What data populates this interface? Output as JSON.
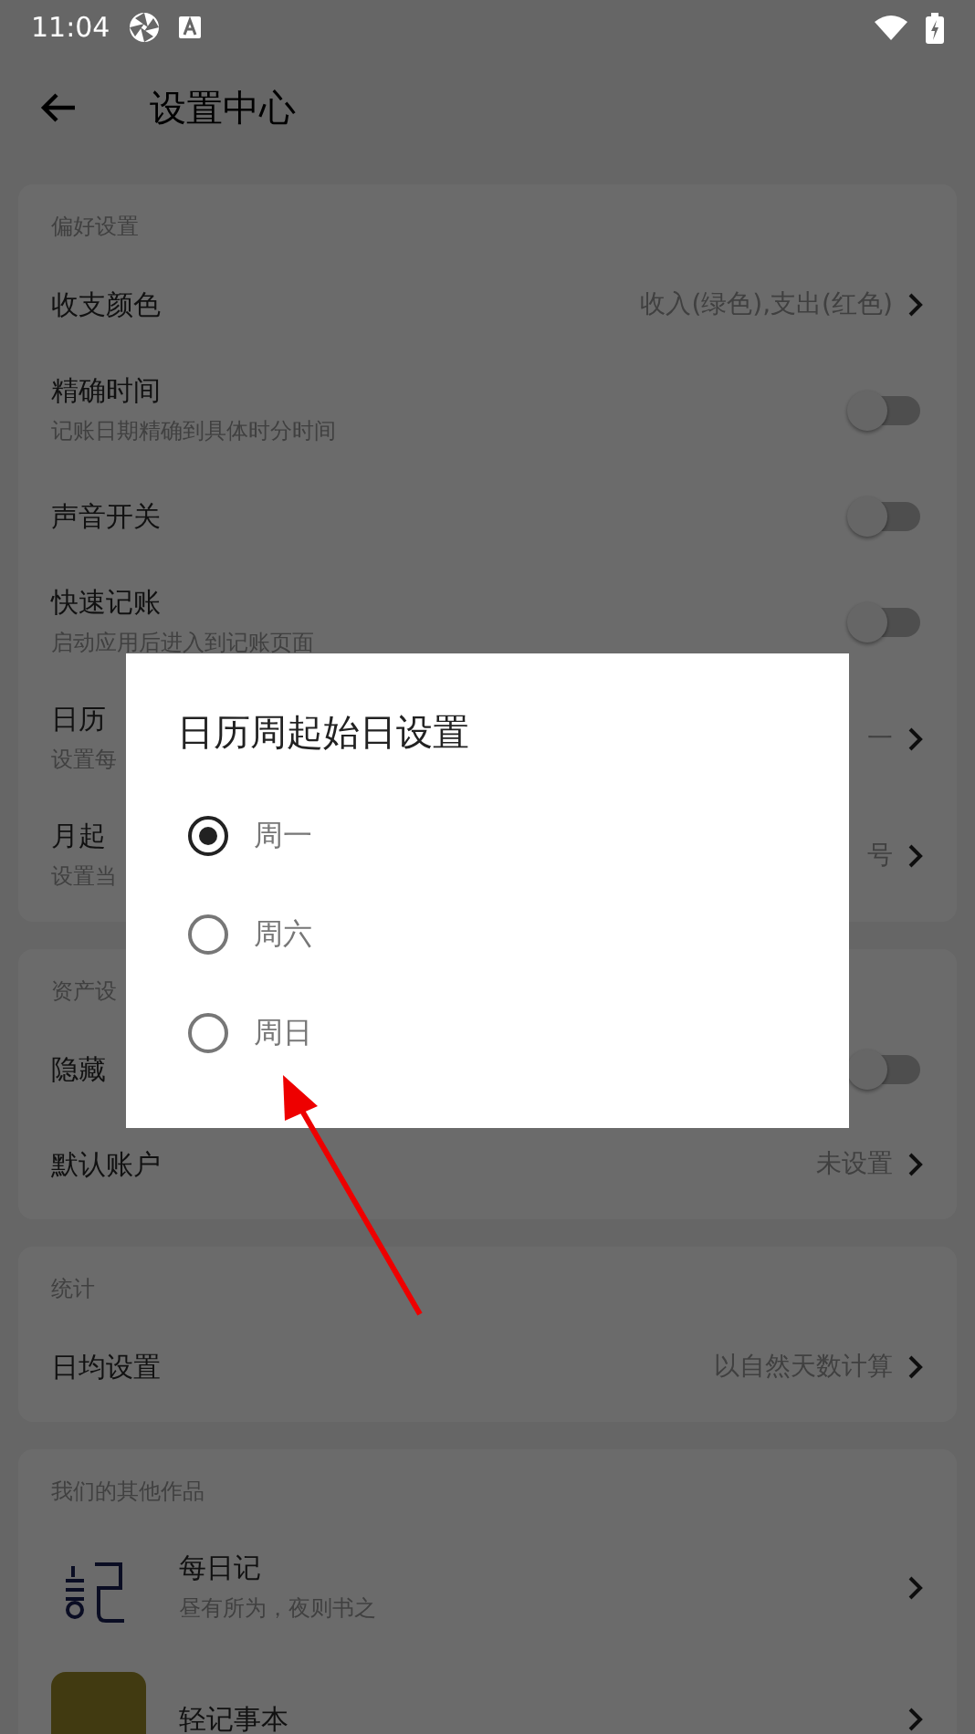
{
  "status_bar": {
    "time": "11:04"
  },
  "app_bar": {
    "title": "设置中心"
  },
  "sections": [
    {
      "header": "偏好设置",
      "rows": [
        {
          "kind": "value",
          "title": "收支颜色",
          "value": "收入(绿色),支出(红色)"
        },
        {
          "kind": "toggle",
          "title": "精确时间",
          "subtitle": "记账日期精确到具体时分时间",
          "on": false
        },
        {
          "kind": "toggle",
          "title": "声音开关",
          "on": false
        },
        {
          "kind": "toggle",
          "title": "快速记账",
          "subtitle": "启动应用后进入到记账页面",
          "on": false
        },
        {
          "kind": "value",
          "title": "日历",
          "subtitle": "设置每",
          "value": "一"
        },
        {
          "kind": "value",
          "title": "月起",
          "subtitle": "设置当",
          "value": "号"
        }
      ]
    },
    {
      "header": "资产设",
      "rows": [
        {
          "kind": "toggle",
          "title": "隐藏",
          "on": false
        },
        {
          "kind": "value",
          "title": "默认账户",
          "value": "未设置"
        }
      ]
    },
    {
      "header": "统计",
      "rows": [
        {
          "kind": "value",
          "title": "日均设置",
          "value": "以自然天数计算"
        }
      ]
    },
    {
      "header": "我们的其他作品",
      "rows": [
        {
          "kind": "app",
          "title": "每日记",
          "subtitle": "昼有所为，夜则书之"
        },
        {
          "kind": "app",
          "title": "轻记事本"
        }
      ]
    }
  ],
  "dialog": {
    "title": "日历周起始日设置",
    "options": [
      {
        "label": "周一",
        "selected": true
      },
      {
        "label": "周六",
        "selected": false
      },
      {
        "label": "周日",
        "selected": false
      }
    ]
  }
}
